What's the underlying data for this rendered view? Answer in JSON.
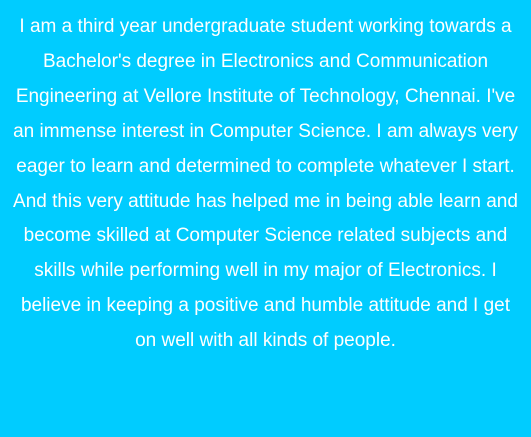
{
  "colors": {
    "background": "#00ccff",
    "text": "#ffffff"
  },
  "about": {
    "paragraph": "I am a third year undergraduate student working towards a Bachelor's degree in Electronics and Communication Engineering at Vellore Institute of Technology, Chennai. I've an immense interest in Computer Science. I am always very eager to learn and determined to complete whatever I start. And this very attitude has helped me in being able learn and become skilled at Computer Science related subjects and skills while performing well in my major of Electronics. I believe in keeping a positive and humble attitude and I get on well with all kinds of people."
  }
}
